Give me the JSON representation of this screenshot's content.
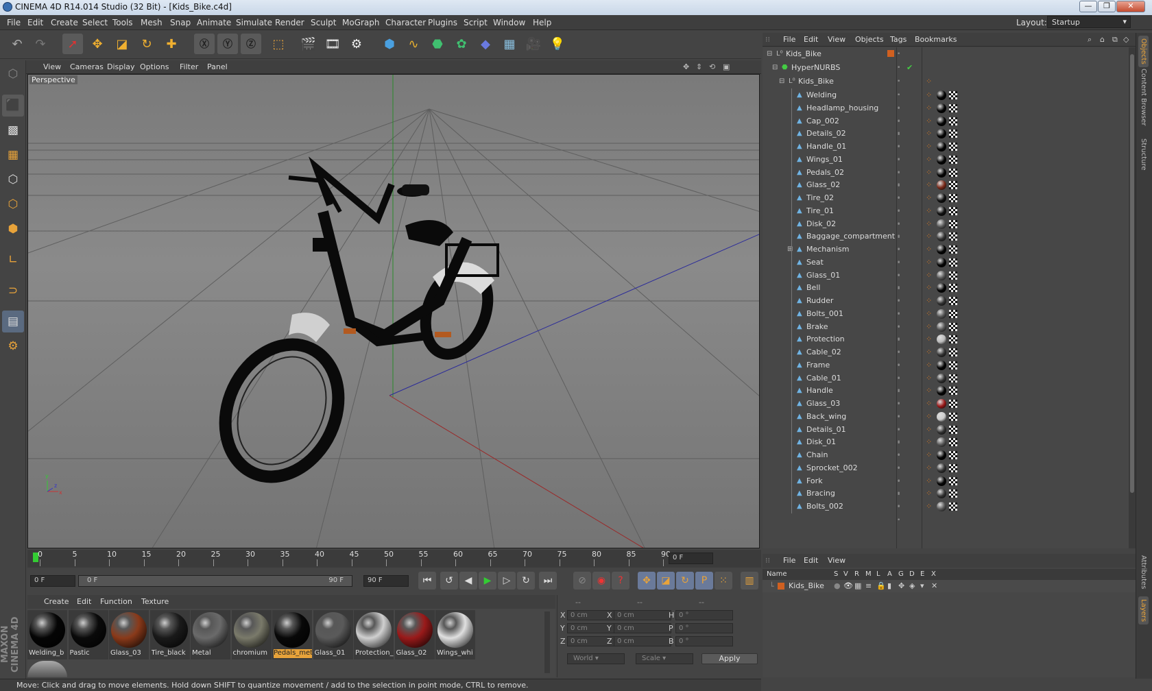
{
  "title": "CINEMA 4D R14.014 Studio (32 Bit) - [Kids_Bike.c4d]",
  "menubar": [
    "File",
    "Edit",
    "Create",
    "Select",
    "Tools",
    "Mesh",
    "Snap",
    "Animate",
    "Simulate",
    "Render",
    "Sculpt",
    "MoGraph",
    "Character",
    "Plugins",
    "Script",
    "Window",
    "Help"
  ],
  "layout": {
    "label": "Layout:",
    "value": "Startup"
  },
  "viewport": {
    "menu": [
      "View",
      "Cameras",
      "Display",
      "Options",
      "Filter",
      "Panel"
    ],
    "label": "Perspective"
  },
  "timeline": {
    "ticks": [
      "0",
      "5",
      "10",
      "15",
      "20",
      "25",
      "30",
      "35",
      "40",
      "45",
      "50",
      "55",
      "60",
      "65",
      "70",
      "75",
      "80",
      "85",
      "90"
    ],
    "current": "0 F"
  },
  "transport": {
    "start": "0 F",
    "range_left": "0 F",
    "range_right": "90 F",
    "end": "90 F"
  },
  "materials": {
    "menu": [
      "Create",
      "Edit",
      "Function",
      "Texture"
    ],
    "items": [
      {
        "name": "Welding_b",
        "color": "#050505"
      },
      {
        "name": "Pastic",
        "color": "#0a0a0a"
      },
      {
        "name": "Glass_03",
        "color": "#8a3a1a"
      },
      {
        "name": "Tire_black",
        "color": "#1a1a1a"
      },
      {
        "name": "Metal",
        "color": "#6a6a6a"
      },
      {
        "name": "chromium",
        "color": "#7a7a6a"
      },
      {
        "name": "Pedals_met",
        "color": "#080808",
        "selected": true
      },
      {
        "name": "Glass_01",
        "color": "#5a5a5a"
      },
      {
        "name": "Protection_",
        "color": "#d0d0d0"
      },
      {
        "name": "Glass_02",
        "color": "#9a1a1a"
      },
      {
        "name": "Wings_whi",
        "color": "#e0e0e0"
      }
    ]
  },
  "coordinates": {
    "header": [
      "--",
      "--",
      "--"
    ],
    "rows": [
      {
        "a": "X",
        "av": "0 cm",
        "b": "X",
        "bv": "0 cm",
        "c": "H",
        "cv": "0 °"
      },
      {
        "a": "Y",
        "av": "0 cm",
        "b": "Y",
        "bv": "0 cm",
        "c": "P",
        "cv": "0 °"
      },
      {
        "a": "Z",
        "av": "0 cm",
        "b": "Z",
        "bv": "0 cm",
        "c": "B",
        "cv": "0 °"
      }
    ],
    "world": "World",
    "scale": "Scale",
    "apply": "Apply"
  },
  "status": "Move: Click and drag to move elements. Hold down SHIFT to quantize movement / add to the selection in point mode, CTRL to remove.",
  "objects": {
    "menu": [
      "File",
      "Edit",
      "View",
      "Objects",
      "Tags",
      "Bookmarks"
    ],
    "root": "Kids_Bike",
    "nurbs": "HyperNURBS",
    "group": "Kids_Bike",
    "children": [
      {
        "name": "Welding",
        "mat": "#050505"
      },
      {
        "name": "Headlamp_housing",
        "mat": "#050505"
      },
      {
        "name": "Cap_002",
        "mat": "#050505"
      },
      {
        "name": "Details_02",
        "mat": "#050505"
      },
      {
        "name": "Handle_01",
        "mat": "#050505"
      },
      {
        "name": "Wings_01",
        "mat": "#050505"
      },
      {
        "name": "Pedals_02",
        "mat": "#050505"
      },
      {
        "name": "Glass_02",
        "mat": "#7a2a1a"
      },
      {
        "name": "Tire_02",
        "mat": "#111111"
      },
      {
        "name": "Tire_01",
        "mat": "#111111"
      },
      {
        "name": "Disk_02",
        "mat": "#555555"
      },
      {
        "name": "Baggage_compartment",
        "mat": "#333333"
      },
      {
        "name": "Mechanism",
        "mat": "#050505",
        "expandable": true
      },
      {
        "name": "Seat",
        "mat": "#050505"
      },
      {
        "name": "Glass_01",
        "mat": "#555555"
      },
      {
        "name": "Bell",
        "mat": "#050505"
      },
      {
        "name": "Rudder",
        "mat": "#333333"
      },
      {
        "name": "Bolts_001",
        "mat": "#555555"
      },
      {
        "name": "Brake",
        "mat": "#555555"
      },
      {
        "name": "Protection",
        "mat": "#bbbbbb"
      },
      {
        "name": "Cable_02",
        "mat": "#333333"
      },
      {
        "name": "Frame",
        "mat": "#050505"
      },
      {
        "name": "Cable_01",
        "mat": "#333333"
      },
      {
        "name": "Handle",
        "mat": "#050505"
      },
      {
        "name": "Glass_03",
        "mat": "#9a1a1a"
      },
      {
        "name": "Back_wing",
        "mat": "#cccccc"
      },
      {
        "name": "Details_01",
        "mat": "#333333"
      },
      {
        "name": "Disk_01",
        "mat": "#555555"
      },
      {
        "name": "Chain",
        "mat": "#050505"
      },
      {
        "name": "Sprocket_002",
        "mat": "#333333"
      },
      {
        "name": "Fork",
        "mat": "#050505"
      },
      {
        "name": "Bracing",
        "mat": "#333333"
      },
      {
        "name": "Bolts_002",
        "mat": "#555555"
      }
    ]
  },
  "attributes": {
    "menu": [
      "File",
      "Edit",
      "View"
    ],
    "columns": [
      "Name",
      "S",
      "V",
      "R",
      "M",
      "L",
      "A",
      "G",
      "D",
      "E",
      "X"
    ],
    "row": "Kids_Bike"
  },
  "righttabs": [
    "Objects",
    "Content Browser",
    "Structure",
    "Attributes",
    "Layers"
  ]
}
